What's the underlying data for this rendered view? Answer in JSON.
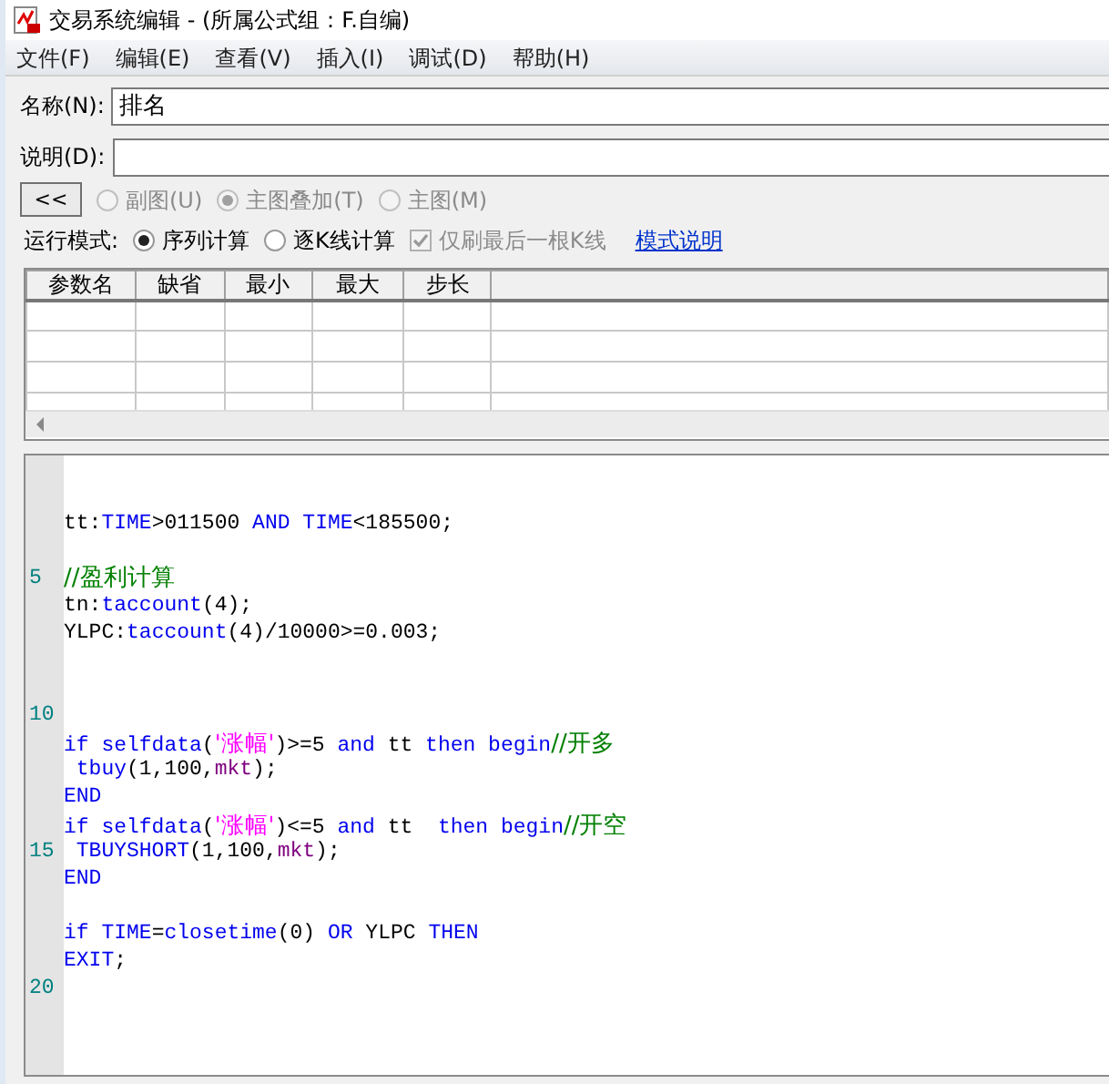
{
  "window": {
    "title": "交易系统编辑 - (所属公式组：F.自编)"
  },
  "menu": [
    "文件(F)",
    "编辑(E)",
    "查看(V)",
    "插入(I)",
    "调试(D)",
    "帮助(H)"
  ],
  "name_field": {
    "label": "名称(N):",
    "value": "排名"
  },
  "description_field": {
    "label": "说明(D):"
  },
  "collapse_button": "<<",
  "chart_options": [
    {
      "label": "副图(U)",
      "selected": false,
      "disabled": true
    },
    {
      "label": "主图叠加(T)",
      "selected": true,
      "disabled": true
    },
    {
      "label": "主图(M)",
      "selected": false,
      "disabled": true
    }
  ],
  "run_mode": {
    "label": "运行模式:",
    "options": [
      {
        "label": "序列计算",
        "selected": true
      },
      {
        "label": "逐K线计算",
        "selected": false
      }
    ],
    "refresh_last_only": {
      "label": "仅刷最后一根K线",
      "checked": true,
      "disabled": true
    },
    "help_link": "模式说明"
  },
  "param_table": {
    "columns": [
      "参数名",
      "缺省",
      "最小",
      "最大",
      "步长"
    ]
  },
  "code_lines": [
    {
      "kind": "blank"
    },
    {
      "kind": "blank"
    },
    {
      "tokens": [
        {
          "kind": "plain",
          "t": "tt:"
        },
        {
          "kind": "kw",
          "t": "TIME"
        },
        {
          "kind": "plain",
          "t": ">011500 "
        },
        {
          "kind": "kw",
          "t": "AND"
        },
        {
          "kind": "kw",
          "t": " TIME"
        },
        {
          "kind": "plain",
          "t": "<185500;"
        }
      ]
    },
    {
      "kind": "blank"
    },
    {
      "number": "5",
      "tokens": [
        {
          "kind": "comment",
          "t": "//盈利计算"
        }
      ]
    },
    {
      "tokens": [
        {
          "kind": "plain",
          "t": "tn:"
        },
        {
          "kind": "kw",
          "t": "taccount"
        },
        {
          "kind": "plain",
          "t": "(4);"
        }
      ]
    },
    {
      "tokens": [
        {
          "kind": "plain",
          "t": "YLPC:"
        },
        {
          "kind": "kw",
          "t": "taccount"
        },
        {
          "kind": "plain",
          "t": "(4)/10000>=0.003;"
        }
      ]
    },
    {
      "kind": "blank"
    },
    {
      "kind": "blank"
    },
    {
      "number": "10"
    },
    {
      "tokens": [
        {
          "kind": "kw",
          "t": "if selfdata"
        },
        {
          "kind": "plain",
          "t": "("
        },
        {
          "kind": "str",
          "t": "'涨幅'"
        },
        {
          "kind": "plain",
          "t": ")>=5 "
        },
        {
          "kind": "kw",
          "t": "and"
        },
        {
          "kind": "plain",
          "t": " tt "
        },
        {
          "kind": "kw",
          "t": "then begin"
        },
        {
          "kind": "comment",
          "t": "//开多"
        }
      ]
    },
    {
      "tokens": [
        {
          "kind": "kw",
          "t": " tbuy"
        },
        {
          "kind": "plain",
          "t": "(1,100,"
        },
        {
          "kind": "const",
          "t": "mkt"
        },
        {
          "kind": "plain",
          "t": ");"
        }
      ]
    },
    {
      "tokens": [
        {
          "kind": "kw",
          "t": "END"
        }
      ]
    },
    {
      "tokens": [
        {
          "kind": "kw",
          "t": "if selfdata"
        },
        {
          "kind": "plain",
          "t": "("
        },
        {
          "kind": "str",
          "t": "'涨幅'"
        },
        {
          "kind": "plain",
          "t": ")<=5 "
        },
        {
          "kind": "kw",
          "t": "and"
        },
        {
          "kind": "plain",
          "t": " tt  "
        },
        {
          "kind": "kw",
          "t": "then begin"
        },
        {
          "kind": "comment",
          "t": "//开空"
        }
      ]
    },
    {
      "number": "15",
      "tokens": [
        {
          "kind": "kw",
          "t": " TBUYSHORT"
        },
        {
          "kind": "plain",
          "t": "(1,100,"
        },
        {
          "kind": "const",
          "t": "mkt"
        },
        {
          "kind": "plain",
          "t": ");"
        }
      ]
    },
    {
      "tokens": [
        {
          "kind": "kw",
          "t": "END"
        }
      ]
    },
    {
      "kind": "blank"
    },
    {
      "tokens": [
        {
          "kind": "kw",
          "t": "if TIME"
        },
        {
          "kind": "plain",
          "t": "="
        },
        {
          "kind": "kw",
          "t": "closetime"
        },
        {
          "kind": "plain",
          "t": "(0) "
        },
        {
          "kind": "kw",
          "t": "OR"
        },
        {
          "kind": "plain",
          "t": " YLPC "
        },
        {
          "kind": "kw",
          "t": "THEN"
        }
      ]
    },
    {
      "tokens": [
        {
          "kind": "kw",
          "t": "EXIT"
        },
        {
          "kind": "plain",
          "t": ";"
        }
      ]
    },
    {
      "number": "20"
    }
  ]
}
